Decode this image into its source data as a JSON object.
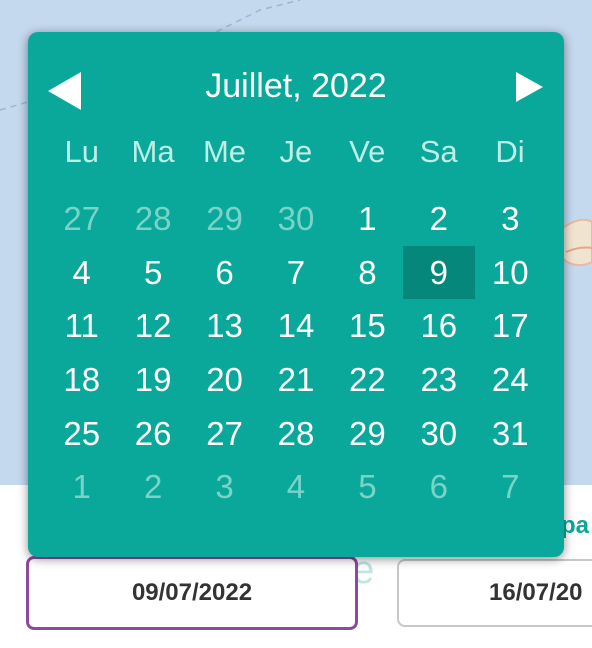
{
  "calendar": {
    "month_title": "Juillet, 2022",
    "prev_icon": "triangle-left-icon",
    "next_icon": "triangle-right-icon",
    "weekdays": [
      "Lu",
      "Ma",
      "Me",
      "Je",
      "Ve",
      "Sa",
      "Di"
    ],
    "days": [
      {
        "label": "27",
        "muted": true
      },
      {
        "label": "28",
        "muted": true
      },
      {
        "label": "29",
        "muted": true
      },
      {
        "label": "30",
        "muted": true
      },
      {
        "label": "1"
      },
      {
        "label": "2"
      },
      {
        "label": "3"
      },
      {
        "label": "4"
      },
      {
        "label": "5"
      },
      {
        "label": "6"
      },
      {
        "label": "7"
      },
      {
        "label": "8"
      },
      {
        "label": "9",
        "selected": true
      },
      {
        "label": "10"
      },
      {
        "label": "11"
      },
      {
        "label": "12"
      },
      {
        "label": "13"
      },
      {
        "label": "14"
      },
      {
        "label": "15"
      },
      {
        "label": "16"
      },
      {
        "label": "17"
      },
      {
        "label": "18"
      },
      {
        "label": "19"
      },
      {
        "label": "20"
      },
      {
        "label": "21"
      },
      {
        "label": "22"
      },
      {
        "label": "23"
      },
      {
        "label": "24"
      },
      {
        "label": "25"
      },
      {
        "label": "26"
      },
      {
        "label": "27"
      },
      {
        "label": "28"
      },
      {
        "label": "29"
      },
      {
        "label": "30"
      },
      {
        "label": "31"
      },
      {
        "label": "1",
        "muted": true
      },
      {
        "label": "2",
        "muted": true
      },
      {
        "label": "3",
        "muted": true
      },
      {
        "label": "4",
        "muted": true
      },
      {
        "label": "5",
        "muted": true
      },
      {
        "label": "6",
        "muted": true
      },
      {
        "label": "7",
        "muted": true
      }
    ]
  },
  "inputs": {
    "start_date": "09/07/2022",
    "end_date": "16/07/20"
  },
  "background": {
    "side_label": "pa",
    "faded_label": "de"
  },
  "colors": {
    "calendar_bg": "#0aa89a",
    "selected_day_bg": "#06877b",
    "muted_day": "#7ad3c8",
    "active_input_border": "#8e4a9e",
    "map_bg": "#c4d8ee"
  }
}
